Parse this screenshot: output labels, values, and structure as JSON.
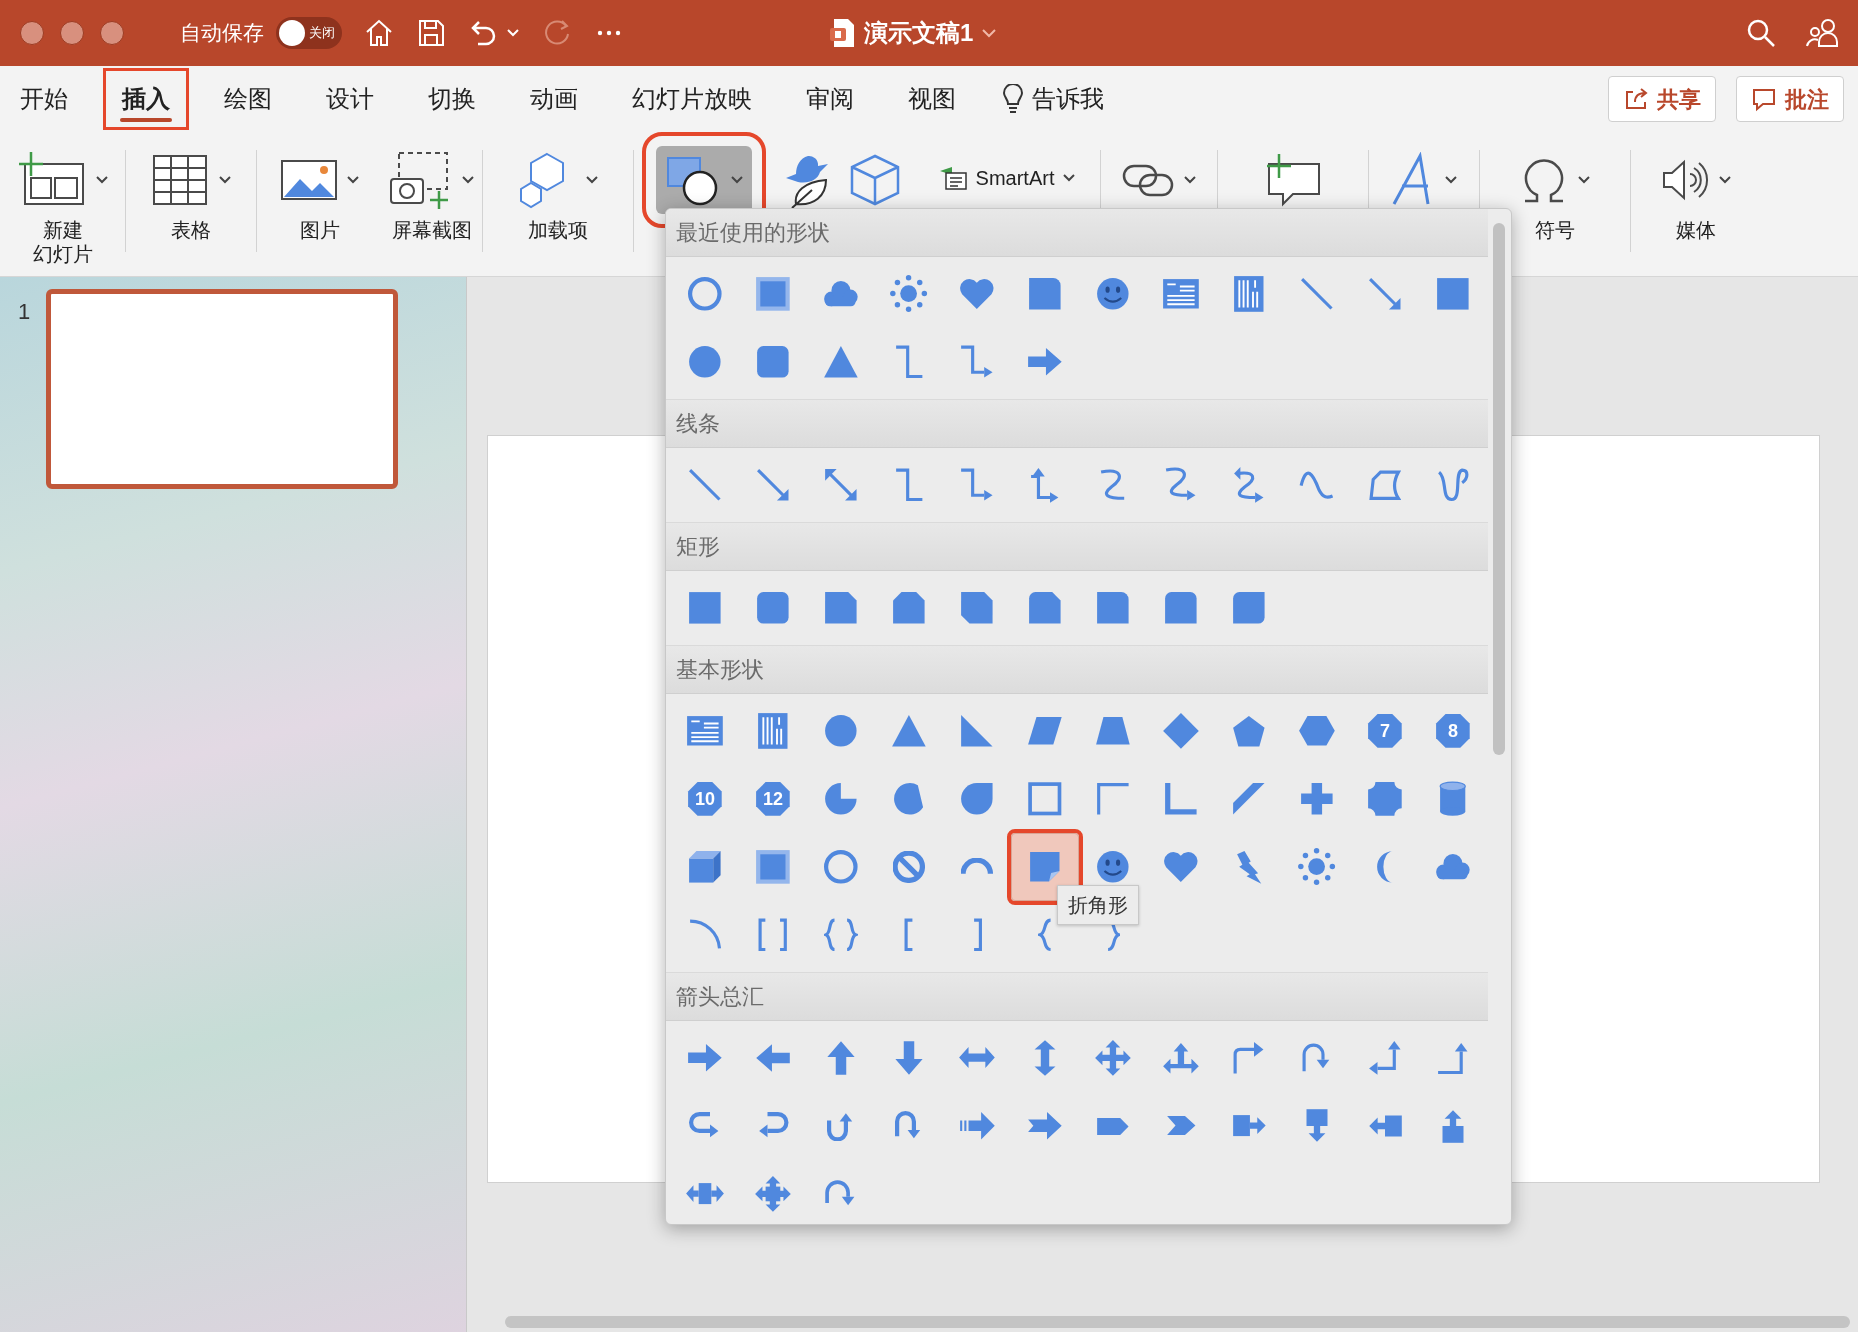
{
  "window": {
    "title": "演示文稿1"
  },
  "quick_access": {
    "autosave_label": "自动保存",
    "autosave": {
      "on": false,
      "label": "关闭"
    },
    "items": [
      {
        "kind": "home",
        "caret": false,
        "disabled": false
      },
      {
        "kind": "save",
        "caret": false,
        "disabled": false
      },
      {
        "kind": "undo",
        "caret": true,
        "disabled": false
      },
      {
        "kind": "redo",
        "caret": false,
        "disabled": true
      },
      {
        "kind": "more",
        "caret": false,
        "disabled": false
      }
    ]
  },
  "tabs": [
    {
      "label": "开始",
      "selected": false
    },
    {
      "label": "插入",
      "selected": true
    },
    {
      "label": "绘图",
      "selected": false
    },
    {
      "label": "设计",
      "selected": false
    },
    {
      "label": "切换",
      "selected": false
    },
    {
      "label": "动画",
      "selected": false
    },
    {
      "label": "幻灯片放映",
      "selected": false
    },
    {
      "label": "审阅",
      "selected": false
    },
    {
      "label": "视图",
      "selected": false
    }
  ],
  "tell_me": "告诉我",
  "buttons": [
    {
      "kind": "share",
      "label": "共享"
    },
    {
      "kind": "comments",
      "label": "批注"
    }
  ],
  "ribbon_groups": [
    [
      {
        "kind": "new-slide",
        "label_lines": [
          "新建",
          "幻灯片"
        ],
        "caret": true,
        "selected": false
      }
    ],
    [
      {
        "kind": "table",
        "label": "表格",
        "caret": true,
        "selected": false
      }
    ],
    [
      {
        "kind": "pictures",
        "label": "图片",
        "caret": true,
        "selected": false
      },
      {
        "kind": "screenshot",
        "label": "屏幕截图",
        "caret": true,
        "selected": false
      }
    ],
    [
      {
        "kind": "add-ins",
        "label": "加载项",
        "caret": true,
        "selected": false
      }
    ],
    [
      {
        "kind": "shapes",
        "caret": true,
        "selected": true
      },
      {
        "kind": "icons",
        "caret": false,
        "selected": false
      },
      {
        "kind": "models",
        "caret": false,
        "selected": false
      },
      {
        "kind": "smartart",
        "label": "SmartArt",
        "caret": true,
        "selected": false
      }
    ],
    [
      {
        "kind": "link",
        "caret": true,
        "selected": false
      }
    ],
    [
      {
        "kind": "comment",
        "caret": false,
        "selected": false
      }
    ],
    [
      {
        "kind": "text",
        "caret": true,
        "selected": false
      }
    ],
    [
      {
        "kind": "symbols",
        "label": "符号",
        "caret": true,
        "selected": false
      }
    ],
    [
      {
        "kind": "media",
        "label": "媒体",
        "caret": true,
        "selected": false
      }
    ]
  ],
  "slides": [
    {
      "number": "1",
      "selected": true
    }
  ],
  "shapes_gallery": {
    "tooltip": "折角形",
    "sections": [
      {
        "title": "最近使用的形状",
        "items": [
          {
            "kind": "ring",
            "selected": false
          },
          {
            "kind": "frame",
            "selected": false
          },
          {
            "kind": "cloud",
            "selected": false
          },
          {
            "kind": "sun",
            "selected": false
          },
          {
            "kind": "heart",
            "selected": false
          },
          {
            "kind": "round1",
            "selected": false
          },
          {
            "kind": "smiley",
            "selected": false
          },
          {
            "kind": "textbox",
            "selected": false
          },
          {
            "kind": "vtextbox",
            "selected": false
          },
          {
            "kind": "line",
            "selected": false
          },
          {
            "kind": "arrowline",
            "selected": false
          },
          {
            "kind": "square",
            "selected": false
          },
          {
            "kind": "disc",
            "selected": false
          },
          {
            "kind": "rrect",
            "selected": false
          },
          {
            "kind": "tri",
            "selected": false
          },
          {
            "kind": "elbow",
            "selected": false
          },
          {
            "kind": "elbowarrow",
            "selected": false
          },
          {
            "kind": "rarr",
            "selected": false
          }
        ]
      },
      {
        "title": "线条",
        "items": [
          {
            "kind": "line",
            "selected": false
          },
          {
            "kind": "arrowline",
            "selected": false
          },
          {
            "kind": "dblarrowline",
            "selected": false
          },
          {
            "kind": "elbow",
            "selected": false
          },
          {
            "kind": "elbowarrow",
            "selected": false
          },
          {
            "kind": "elbowdbl",
            "selected": false
          },
          {
            "kind": "curve",
            "selected": false
          },
          {
            "kind": "curvearrow",
            "selected": false
          },
          {
            "kind": "curvedbl",
            "selected": false
          },
          {
            "kind": "wave",
            "selected": false
          },
          {
            "kind": "freeform",
            "selected": false
          },
          {
            "kind": "scribble",
            "selected": false
          }
        ]
      },
      {
        "title": "矩形",
        "items": [
          {
            "kind": "square",
            "selected": false
          },
          {
            "kind": "rrect",
            "selected": false
          },
          {
            "kind": "snip1",
            "selected": false
          },
          {
            "kind": "snip2",
            "selected": false
          },
          {
            "kind": "snipdiag",
            "selected": false
          },
          {
            "kind": "sniprnd",
            "selected": false
          },
          {
            "kind": "round1",
            "selected": false
          },
          {
            "kind": "round2",
            "selected": false
          },
          {
            "kind": "rounddiag",
            "selected": false
          }
        ]
      },
      {
        "title": "基本形状",
        "items": [
          {
            "kind": "textbox",
            "selected": false
          },
          {
            "kind": "vtextbox",
            "selected": false
          },
          {
            "kind": "disc",
            "selected": false
          },
          {
            "kind": "tri",
            "selected": false
          },
          {
            "kind": "rtri",
            "selected": false
          },
          {
            "kind": "para",
            "selected": false
          },
          {
            "kind": "trap",
            "selected": false
          },
          {
            "kind": "diamond",
            "selected": false
          },
          {
            "kind": "pent",
            "selected": false
          },
          {
            "kind": "hex",
            "selected": false
          },
          {
            "kind": "hept",
            "label": "7",
            "selected": false
          },
          {
            "kind": "oct",
            "label": "8",
            "selected": false
          },
          {
            "kind": "dec",
            "label": "10",
            "selected": false
          },
          {
            "kind": "dodec",
            "label": "12",
            "selected": false
          },
          {
            "kind": "pie",
            "selected": false
          },
          {
            "kind": "chord",
            "selected": false
          },
          {
            "kind": "tear",
            "selected": false
          },
          {
            "kind": "frameoutline",
            "selected": false
          },
          {
            "kind": "halfframe",
            "selected": false
          },
          {
            "kind": "lshape",
            "selected": false
          },
          {
            "kind": "diagstripe",
            "selected": false
          },
          {
            "kind": "plus",
            "selected": false
          },
          {
            "kind": "plaque",
            "selected": false
          },
          {
            "kind": "can",
            "selected": false
          },
          {
            "kind": "cube",
            "selected": false
          },
          {
            "kind": "frame",
            "selected": false
          },
          {
            "kind": "ring",
            "selected": false
          },
          {
            "kind": "nosign",
            "selected": false
          },
          {
            "kind": "blockarc",
            "selected": false
          },
          {
            "kind": "folded",
            "selected": true
          },
          {
            "kind": "smiley",
            "selected": false
          },
          {
            "kind": "heart",
            "selected": false
          },
          {
            "kind": "lightning",
            "selected": false
          },
          {
            "kind": "sun",
            "selected": false
          },
          {
            "kind": "moon",
            "selected": false
          },
          {
            "kind": "cloud",
            "selected": false
          },
          {
            "kind": "arc",
            "selected": false
          },
          {
            "kind": "dbracket",
            "selected": false
          },
          {
            "kind": "dbrace",
            "selected": false
          },
          {
            "kind": "lbracket",
            "selected": false
          },
          {
            "kind": "rbracket",
            "selected": false
          },
          {
            "kind": "lbrace",
            "selected": false
          },
          {
            "kind": "rbrace",
            "selected": false
          }
        ]
      },
      {
        "title": "箭头总汇",
        "items": [
          {
            "kind": "rarr",
            "selected": false
          },
          {
            "kind": "larr",
            "selected": false
          },
          {
            "kind": "uarr",
            "selected": false
          },
          {
            "kind": "darr",
            "selected": false
          },
          {
            "kind": "lrarr",
            "selected": false
          },
          {
            "kind": "udarr",
            "selected": false
          },
          {
            "kind": "quadarr",
            "selected": false
          },
          {
            "kind": "lruarr",
            "selected": false
          },
          {
            "kind": "bentarr",
            "selected": false
          },
          {
            "kind": "uturnarr",
            "selected": false
          },
          {
            "kind": "leftuparr",
            "selected": false
          },
          {
            "kind": "bentuparr",
            "selected": false
          },
          {
            "kind": "curvedright",
            "selected": false
          },
          {
            "kind": "curvedleft",
            "selected": false
          },
          {
            "kind": "curvedup",
            "selected": false
          },
          {
            "kind": "curveddown",
            "selected": false
          },
          {
            "kind": "stripedarr",
            "selected": false
          },
          {
            "kind": "notchedarr",
            "selected": false
          },
          {
            "kind": "pentarr",
            "selected": false
          },
          {
            "kind": "chevron",
            "selected": false
          },
          {
            "kind": "rcallout",
            "selected": false
          },
          {
            "kind": "dcallout",
            "selected": false
          },
          {
            "kind": "lcallout",
            "selected": false
          },
          {
            "kind": "ucallout",
            "selected": false
          },
          {
            "kind": "lrcallout",
            "selected": false
          },
          {
            "kind": "quadcallout",
            "selected": false
          },
          {
            "kind": "circarr",
            "selected": false
          }
        ]
      }
    ]
  }
}
